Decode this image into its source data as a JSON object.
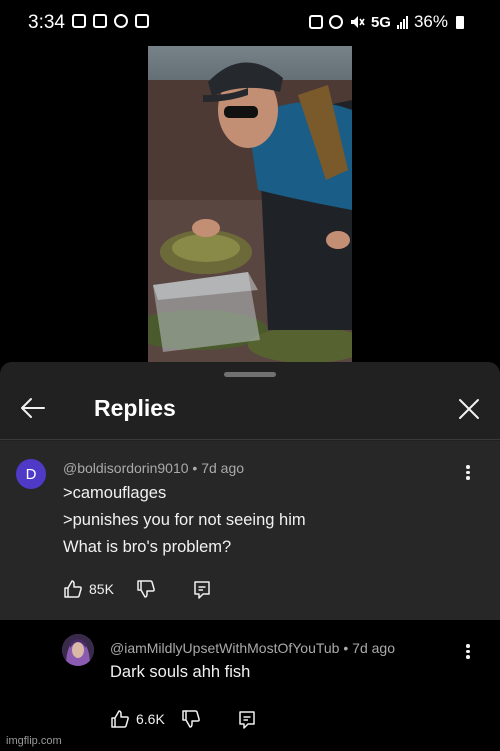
{
  "status_bar": {
    "time": "3:34",
    "network": "5G",
    "battery": "36%"
  },
  "sheet": {
    "title": "Replies"
  },
  "comment": {
    "avatar_letter": "D",
    "author": "@boldisordorin9010",
    "age": "7d ago",
    "lines": [
      ">camouflages",
      ">punishes you for not seeing him",
      "What is bro's problem?"
    ],
    "likes": "85K"
  },
  "reply": {
    "author": "@iamMildlyUpsetWithMostOfYouTub",
    "age": "7d ago",
    "text": "Dark souls ahh fish",
    "likes": "6.6K"
  },
  "watermark": "imgflip.com",
  "colors": {
    "sheet_bg": "#212121",
    "comment_bg": "#272727",
    "avatar": "#4f3ac7",
    "text": "#f1f1f1",
    "meta": "#aaaaaa"
  }
}
